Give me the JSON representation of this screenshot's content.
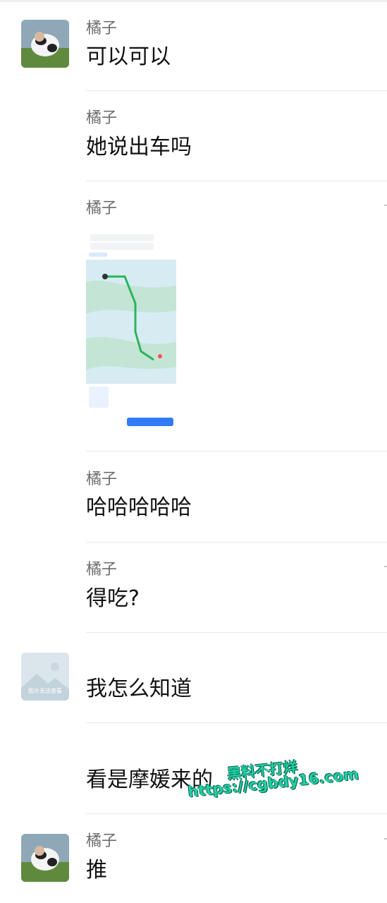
{
  "messages": [
    {
      "sender": "橘子",
      "text": "可以可以"
    },
    {
      "sender": "橘子",
      "text": "她说出车吗"
    },
    {
      "sender": "橘子",
      "image": "map-route-screenshot"
    },
    {
      "sender": "橘子",
      "text": "哈哈哈哈哈"
    },
    {
      "sender": "橘子",
      "text": "得吃?"
    },
    {
      "sender": "",
      "text": "我怎么知道",
      "avatar_caption": "图片无法查看"
    },
    {
      "sender": "",
      "text": "看是摩媛来的"
    },
    {
      "sender": "橘子",
      "text": "推"
    }
  ],
  "watermark": {
    "line1": "黑料不打烊",
    "line2": "https://cgbdy16.com"
  },
  "colors": {
    "background": "#ffffff",
    "sender": "#6d6d6d",
    "text": "#111111",
    "divider": "#e9e9e9",
    "watermark": "#1fd1a4"
  }
}
